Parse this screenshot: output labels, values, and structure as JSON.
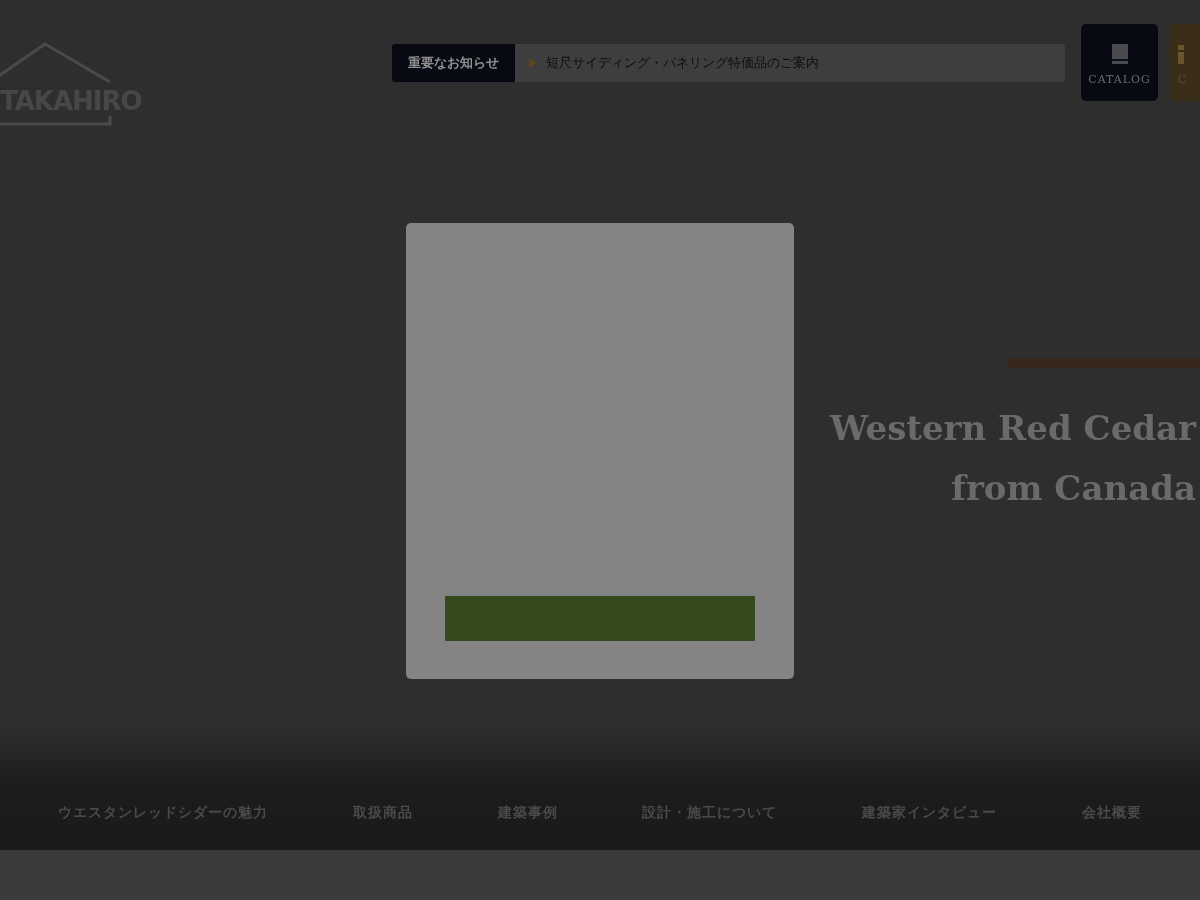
{
  "header": {
    "logo": "TAKAHIRO",
    "notice": {
      "label": "重要なお知らせ",
      "text": "短尺サイディング・パネリング特価品のご案内"
    },
    "buttons": [
      {
        "label": "CATALOG",
        "kind": "catalog"
      },
      {
        "label": "C",
        "kind": "contact"
      }
    ]
  },
  "hero": {
    "lines": [
      "Western Red Cedar",
      "from Canada"
    ]
  },
  "nav": {
    "items": [
      "ウエスタンレッドシダーの魅力",
      "取扱商品",
      "建築事例",
      "設計・施工について",
      "建築家インタビュー",
      "会社概要"
    ]
  }
}
